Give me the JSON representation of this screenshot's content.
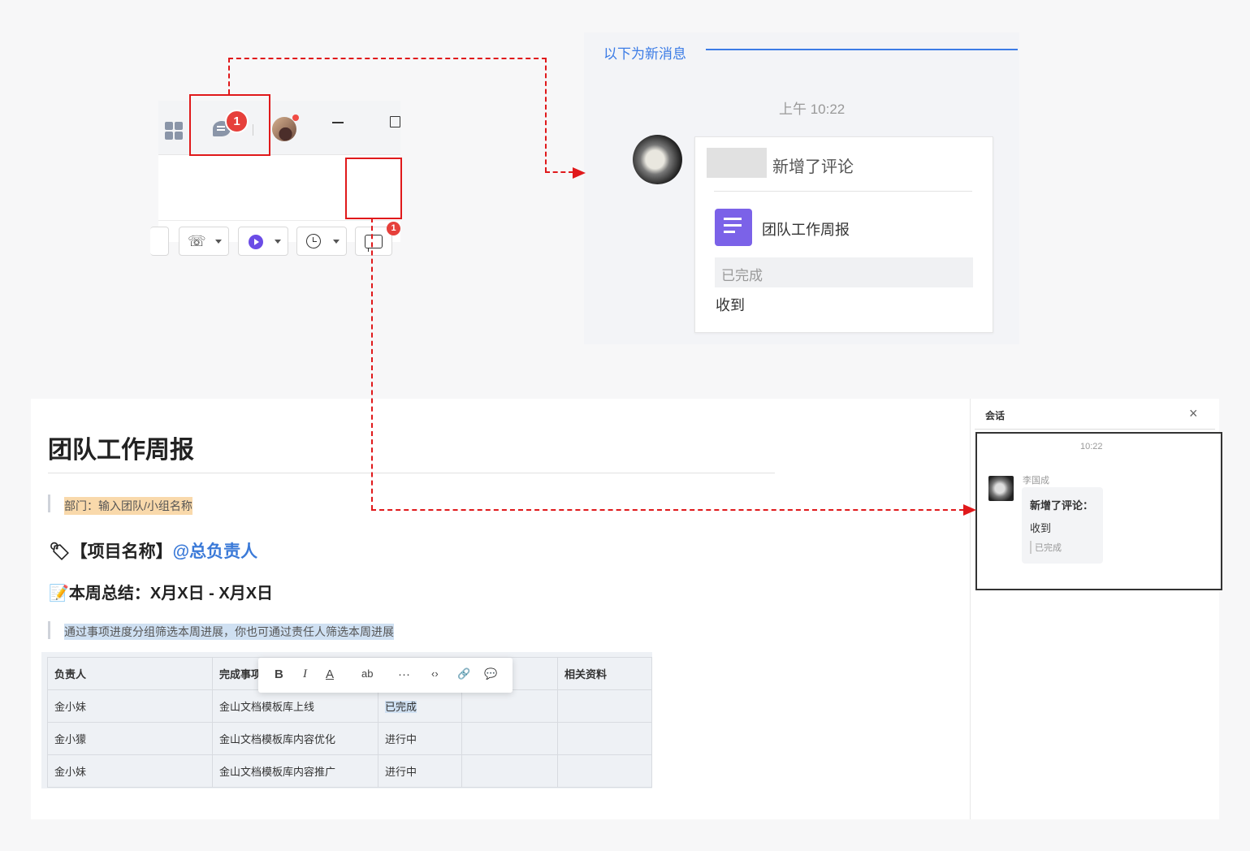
{
  "toolbar": {
    "chat_badge": "1",
    "comment_badge": "1"
  },
  "message_panel": {
    "new_messages_label": "以下为新消息",
    "time": "上午 10:22",
    "card": {
      "title": "新增了评论",
      "doc_title": "团队工作周报",
      "quoted": "已完成",
      "reply": "收到"
    }
  },
  "document": {
    "title": "团队工作周报",
    "dept_line": "部门：输入团队/小组名称",
    "project_prefix": "【项目名称】",
    "project_owner": "@总负责人",
    "summary": "本周总结：X月X日 - X月X日",
    "hint": "通过事项进度分组筛选本周进展，你也可通过责任人筛选本周进展",
    "table": {
      "headers": [
        "负责人",
        "完成事项",
        "",
        "",
        "相关资料"
      ],
      "rows": [
        [
          "金小妹",
          "金山文档模板库上线",
          "已完成",
          "",
          ""
        ],
        [
          "金小獴",
          "金山文档模板库内容优化",
          "进行中",
          "",
          ""
        ],
        [
          "金小妹",
          "金山文档模板库内容推广",
          "进行中",
          "",
          ""
        ]
      ]
    },
    "float_toolbar": {
      "bold": "B",
      "italic": "I",
      "font_color": "A",
      "highlight": "ab",
      "more": "···",
      "code": "‹›",
      "link": "🔗",
      "comment": "💬"
    }
  },
  "conversation": {
    "title": "会话",
    "close": "×",
    "time": "10:22",
    "sender": "李国成",
    "bubble_title": "新增了评论：",
    "bubble_reply": "收到",
    "bubble_quote": "已完成"
  },
  "colors": {
    "highlight_red": "#e0191b",
    "link_blue": "#3c7ce6",
    "doc_purple": "#7b62e8"
  }
}
